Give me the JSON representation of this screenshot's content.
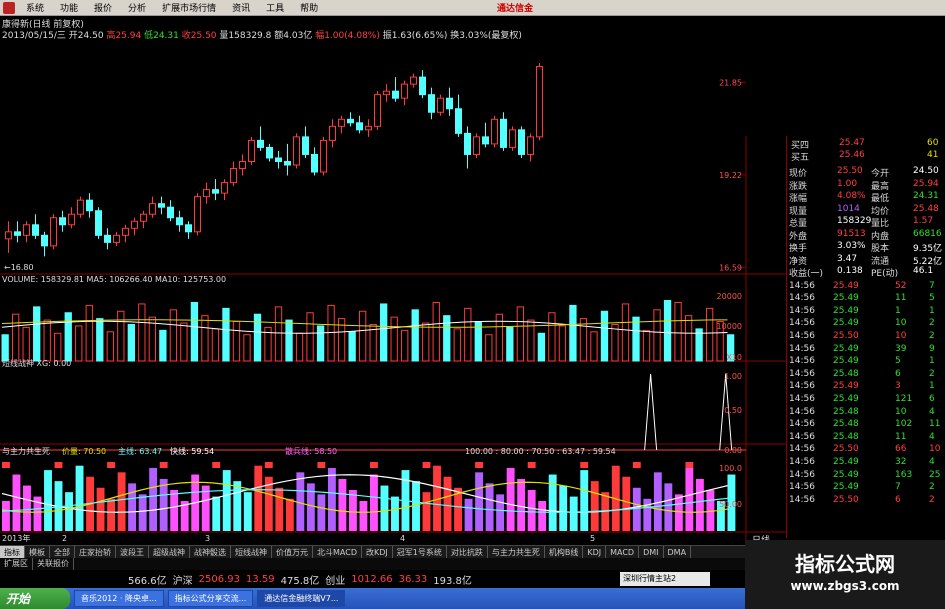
{
  "menu": {
    "items": [
      "系统",
      "功能",
      "报价",
      "分析",
      "扩展市场行情",
      "资讯",
      "工具",
      "帮助"
    ],
    "brand": "通达信金"
  },
  "info": {
    "title": "康得新(日线 前复权)",
    "date": "2013/05/15/三",
    "open_label": "开",
    "open": "24.50",
    "high_label": "高",
    "high": "25.94",
    "low_label": "低",
    "low": "24.31",
    "close_label": "收",
    "close": "25.50",
    "vol_label": "量",
    "vol": "158329.8",
    "amt_label": "额",
    "amt": "4.03亿",
    "chg_label": "幅",
    "chg": "1.00(4.08%)",
    "amp_label": "振",
    "amp": "1.63(6.65%)",
    "turn_label": "换",
    "turn": "3.03%(最复权)"
  },
  "chart_data": {
    "type": "candlestick",
    "price_labels": [
      "21.85",
      "19.22",
      "16.59"
    ],
    "low_marker": "16.80",
    "candles": [
      [
        17.4,
        17.9,
        17.0,
        17.6
      ],
      [
        17.6,
        17.9,
        17.3,
        17.5
      ],
      [
        17.5,
        17.9,
        17.3,
        17.8
      ],
      [
        17.8,
        18.1,
        17.4,
        17.5
      ],
      [
        17.5,
        17.6,
        16.9,
        17.2
      ],
      [
        17.2,
        18.1,
        17.1,
        18.0
      ],
      [
        18.0,
        18.2,
        17.6,
        17.8
      ],
      [
        17.8,
        18.3,
        17.7,
        18.1
      ],
      [
        18.1,
        18.6,
        18.0,
        18.5
      ],
      [
        18.5,
        18.7,
        18.0,
        18.2
      ],
      [
        18.2,
        18.3,
        17.4,
        17.5
      ],
      [
        17.5,
        17.7,
        17.1,
        17.3
      ],
      [
        17.3,
        17.6,
        17.2,
        17.5
      ],
      [
        17.5,
        17.8,
        17.3,
        17.7
      ],
      [
        17.7,
        18.0,
        17.5,
        17.9
      ],
      [
        17.9,
        18.2,
        17.7,
        18.1
      ],
      [
        18.1,
        18.6,
        18.0,
        18.4
      ],
      [
        18.4,
        18.6,
        18.1,
        18.3
      ],
      [
        18.3,
        18.5,
        17.9,
        18.0
      ],
      [
        18.0,
        18.2,
        17.6,
        17.8
      ],
      [
        17.8,
        17.9,
        17.4,
        17.6
      ],
      [
        17.6,
        18.7,
        17.5,
        18.6
      ],
      [
        18.6,
        19.0,
        18.4,
        18.8
      ],
      [
        18.8,
        19.1,
        18.5,
        18.7
      ],
      [
        18.7,
        19.1,
        18.5,
        19.0
      ],
      [
        19.0,
        19.6,
        18.9,
        19.4
      ],
      [
        19.4,
        19.8,
        19.2,
        19.6
      ],
      [
        19.6,
        20.3,
        19.5,
        20.2
      ],
      [
        20.2,
        20.6,
        19.9,
        20.0
      ],
      [
        20.0,
        20.1,
        19.6,
        19.7
      ],
      [
        19.7,
        19.9,
        19.4,
        19.6
      ],
      [
        19.6,
        20.1,
        19.2,
        19.5
      ],
      [
        19.5,
        20.4,
        19.4,
        20.3
      ],
      [
        20.3,
        20.6,
        19.7,
        19.8
      ],
      [
        19.8,
        20.0,
        19.2,
        19.3
      ],
      [
        19.3,
        20.3,
        19.2,
        20.2
      ],
      [
        20.2,
        20.8,
        20.0,
        20.6
      ],
      [
        20.6,
        20.9,
        20.4,
        20.8
      ],
      [
        20.8,
        21.0,
        20.6,
        20.7
      ],
      [
        20.7,
        20.9,
        20.4,
        20.5
      ],
      [
        20.5,
        20.8,
        20.3,
        20.6
      ],
      [
        20.6,
        21.6,
        20.5,
        21.5
      ],
      [
        21.5,
        21.8,
        21.3,
        21.6
      ],
      [
        21.6,
        22.0,
        21.3,
        21.4
      ],
      [
        21.4,
        21.9,
        21.2,
        21.8
      ],
      [
        21.8,
        22.1,
        21.7,
        22.0
      ],
      [
        22.0,
        22.2,
        21.4,
        21.5
      ],
      [
        21.5,
        21.7,
        20.8,
        21.0
      ],
      [
        21.0,
        21.5,
        20.9,
        21.4
      ],
      [
        21.4,
        21.7,
        20.9,
        21.1
      ],
      [
        21.1,
        21.5,
        20.3,
        20.4
      ],
      [
        20.4,
        20.6,
        19.4,
        19.8
      ],
      [
        19.8,
        20.4,
        19.7,
        20.3
      ],
      [
        20.3,
        20.7,
        20.0,
        20.1
      ],
      [
        20.1,
        20.9,
        20.0,
        20.8
      ],
      [
        20.8,
        21.0,
        19.9,
        20.0
      ],
      [
        20.0,
        20.6,
        19.9,
        20.5
      ],
      [
        20.5,
        20.6,
        19.7,
        19.8
      ],
      [
        19.8,
        20.4,
        19.6,
        20.3
      ],
      [
        20.3,
        22.4,
        20.2,
        22.3
      ]
    ],
    "volume_label": "VOLUME: 158329.81  MA5: 106266.40  MA10: 125753.00",
    "volume_ticks": [
      "20000",
      "10000",
      "X10"
    ],
    "ind1_label": "短线战神 XG: 0.00",
    "ind1_ticks": [
      "1.00",
      "0.50",
      "0.00"
    ],
    "ind1_spikes": [
      52,
      58
    ],
    "ind2_label": "与主力共生死",
    "ind2_params": [
      "价量: 70.50",
      "主线: 63.47",
      "快线: 59.54",
      "散兵线: 58.50"
    ],
    "ind2_params2": [
      "100.00",
      "80.00",
      "70.50",
      "63.47",
      "59.54"
    ],
    "ind2_ticks": [
      "100.0",
      "50.00"
    ],
    "x_labels": [
      "2013年",
      "2",
      "3",
      "4",
      "5"
    ],
    "period": "日线"
  },
  "quote": {
    "top_rows": [
      {
        "label": "买四",
        "price": "25.47",
        "vol": "60"
      },
      {
        "label": "买五",
        "price": "25.46",
        "vol": "41"
      }
    ],
    "rows": [
      {
        "l1": "现价",
        "v1": "25.50",
        "l2": "今开",
        "v2": "24.50",
        "c1": "#ff4040",
        "c2": "#ffffff"
      },
      {
        "l1": "涨跌",
        "v1": "1.00",
        "l2": "最高",
        "v2": "25.94",
        "c1": "#ff4040",
        "c2": "#ff4040"
      },
      {
        "l1": "涨幅",
        "v1": "4.08%",
        "l2": "最低",
        "v2": "24.31",
        "c1": "#ff4040",
        "c2": "#30e030"
      },
      {
        "l1": "现量",
        "v1": "1014",
        "l2": "均价",
        "v2": "25.48",
        "c1": "#b060ff",
        "c2": "#ff4040"
      },
      {
        "l1": "总量",
        "v1": "158329",
        "l2": "量比",
        "v2": "1.57",
        "c1": "#ffffff",
        "c2": "#ff4040"
      },
      {
        "l1": "外盘",
        "v1": "91513",
        "l2": "内盘",
        "v2": "66816",
        "c1": "#ff4040",
        "c2": "#30e030"
      },
      {
        "l1": "换手",
        "v1": "3.03%",
        "l2": "股本",
        "v2": "9.35亿",
        "c1": "#ffffff",
        "c2": "#ffffff"
      },
      {
        "l1": "净资",
        "v1": "3.47",
        "l2": "流通",
        "v2": "5.22亿",
        "c1": "#ffffff",
        "c2": "#ffffff"
      },
      {
        "l1": "收益(一)",
        "v1": "0.138",
        "l2": "PE(动)",
        "v2": "46.1",
        "c1": "#ffffff",
        "c2": "#ffffff"
      }
    ],
    "ticks": [
      {
        "t": "14:56",
        "p": "25.49",
        "v": "52",
        "d": "7",
        "c": "#ff4040",
        "dc": "#30e030"
      },
      {
        "t": "14:56",
        "p": "25.49",
        "v": "11",
        "d": "5",
        "c": "#30e030",
        "dc": "#30e030"
      },
      {
        "t": "14:56",
        "p": "25.49",
        "v": "1",
        "d": "1",
        "c": "#30e030",
        "dc": "#30e030"
      },
      {
        "t": "14:56",
        "p": "25.49",
        "v": "10",
        "d": "2",
        "c": "#30e030",
        "dc": "#30e030"
      },
      {
        "t": "14:56",
        "p": "25.50",
        "v": "10",
        "d": "2",
        "c": "#ff4040",
        "dc": "#30e030"
      },
      {
        "t": "14:56",
        "p": "25.49",
        "v": "39",
        "d": "9",
        "c": "#30e030",
        "dc": "#30e030"
      },
      {
        "t": "14:56",
        "p": "25.49",
        "v": "5",
        "d": "1",
        "c": "#30e030",
        "dc": "#30e030"
      },
      {
        "t": "14:56",
        "p": "25.48",
        "v": "6",
        "d": "2",
        "c": "#30e030",
        "dc": "#30e030"
      },
      {
        "t": "14:56",
        "p": "25.49",
        "v": "3",
        "d": "1",
        "c": "#ff4040",
        "dc": "#30e030"
      },
      {
        "t": "14:56",
        "p": "25.49",
        "v": "121",
        "d": "6",
        "c": "#30e030",
        "dc": "#30e030"
      },
      {
        "t": "14:56",
        "p": "25.48",
        "v": "10",
        "d": "4",
        "c": "#30e030",
        "dc": "#30e030"
      },
      {
        "t": "14:56",
        "p": "25.48",
        "v": "102",
        "d": "11",
        "c": "#30e030",
        "dc": "#30e030"
      },
      {
        "t": "14:56",
        "p": "25.48",
        "v": "11",
        "d": "4",
        "c": "#30e030",
        "dc": "#30e030"
      },
      {
        "t": "14:56",
        "p": "25.50",
        "v": "66",
        "d": "10",
        "c": "#ff4040",
        "dc": "#ff4040"
      },
      {
        "t": "14:56",
        "p": "25.49",
        "v": "32",
        "d": "4",
        "c": "#30e030",
        "dc": "#30e030"
      },
      {
        "t": "14:56",
        "p": "25.49",
        "v": "163",
        "d": "25",
        "c": "#30e030",
        "dc": "#30e030"
      },
      {
        "t": "14:56",
        "p": "25.49",
        "v": "7",
        "d": "2",
        "c": "#30e030",
        "dc": "#30e030"
      },
      {
        "t": "14:56",
        "p": "25.50",
        "v": "6",
        "d": "2",
        "c": "#ff4040",
        "dc": "#ff4040"
      }
    ]
  },
  "tabs": [
    "指标",
    "模板",
    "全部",
    "庄家抬轿",
    "波段王",
    "超级战神",
    "战神骰选",
    "短线战神",
    "价值万元",
    "北斗MACD",
    "改KDJ",
    "冠军1号系统",
    "对比抗跌",
    "与主力共生死",
    "机构B线",
    "KDJ",
    "MACD",
    "DMI",
    "DMA"
  ],
  "tabs2": [
    "扩展区",
    "关联报价"
  ],
  "status": {
    "sh_val": "566.6亿",
    "sz_label": "沪深",
    "sz_idx": "2506.93",
    "sz_chg": "13.59",
    "sz_amt": "475.8亿",
    "cy_label": "创业",
    "cy_idx": "1012.66",
    "cy_chg": "36.33",
    "cy_amt": "193.8亿",
    "server": "深圳行情主站2"
  },
  "taskbar": {
    "start": "开始",
    "items": [
      "音乐2012 · 降央卓...",
      "指标公式分享交流...",
      "通达信金融终端V7..."
    ]
  },
  "watermark": {
    "t1": "指标公式网",
    "t2": "www.zbgs3.com"
  }
}
